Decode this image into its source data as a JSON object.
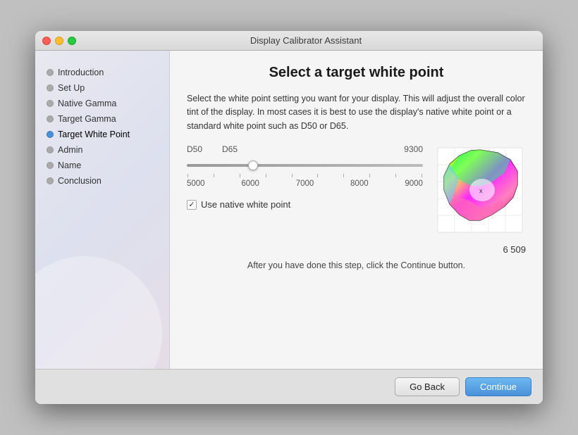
{
  "window": {
    "title": "Display Calibrator Assistant"
  },
  "sidebar": {
    "items": [
      {
        "label": "Introduction",
        "state": "grey"
      },
      {
        "label": "Set Up",
        "state": "grey"
      },
      {
        "label": "Native Gamma",
        "state": "grey"
      },
      {
        "label": "Target Gamma",
        "state": "grey"
      },
      {
        "label": "Target White Point",
        "state": "blue"
      },
      {
        "label": "Admin",
        "state": "grey"
      },
      {
        "label": "Name",
        "state": "grey"
      },
      {
        "label": "Conclusion",
        "state": "grey"
      }
    ]
  },
  "main": {
    "title": "Select a target white point",
    "description": "Select the white point setting you want for your display.  This will adjust the overall color tint of the display.  In most cases it is best to use the display's native white point or a standard white point such as D50 or D65.",
    "slider": {
      "top_labels": [
        "D50",
        "D65",
        "9300"
      ],
      "bottom_labels": [
        "5000",
        "6000",
        "7000",
        "8000",
        "9000"
      ]
    },
    "checkbox": {
      "label": "Use native white point",
      "checked": true
    },
    "value_display": "6 509",
    "instruction": "After you have done this step, click the Continue button."
  },
  "footer": {
    "go_back_label": "Go Back",
    "continue_label": "Continue"
  }
}
